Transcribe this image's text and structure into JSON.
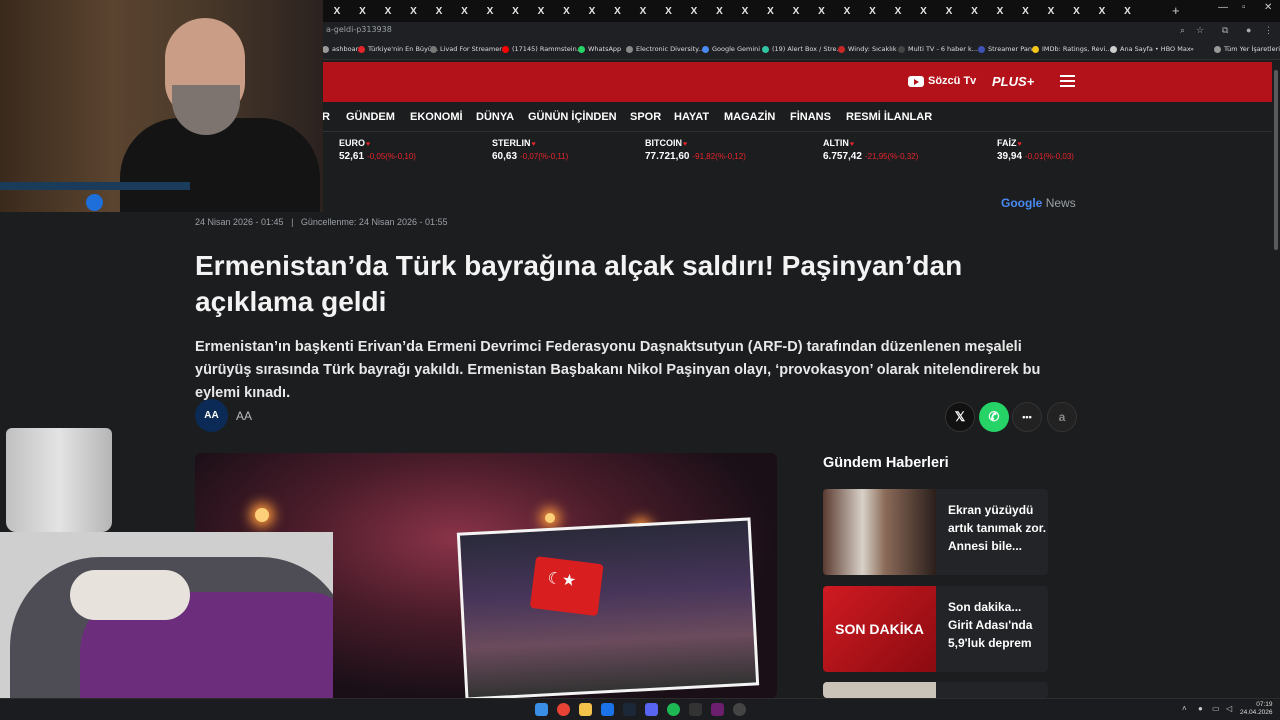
{
  "browser": {
    "tab_icon": "X",
    "tab_count": 32,
    "url": "a-geldi-p313938",
    "bookmarks": [
      {
        "label": "ashboard",
        "color": "#999999"
      },
      {
        "label": "Türkiye'nin En Büyü...",
        "color": "#e5252c"
      },
      {
        "label": "Livad For Streamers",
        "color": "#777777"
      },
      {
        "label": "(17145) Rammstein...",
        "color": "#ff0000"
      },
      {
        "label": "WhatsApp",
        "color": "#25d366"
      },
      {
        "label": "Electronic Diversity...",
        "color": "#888888"
      },
      {
        "label": "Google Gemini",
        "color": "#4a8af4"
      },
      {
        "label": "(19) Alert Box / Stre...",
        "color": "#31c3a2"
      },
      {
        "label": "Windy: Sıcaklık",
        "color": "#c62828"
      },
      {
        "label": "Multi TV - 6 haber k...",
        "color": "#444444"
      },
      {
        "label": "Streamer Panel",
        "color": "#3f51b5"
      },
      {
        "label": "IMDb: Ratings, Revi...",
        "color": "#f5c518"
      },
      {
        "label": "Ana Sayfa • HBO Max",
        "color": "#cccccc"
      },
      {
        "label": "»",
        "color": ""
      },
      {
        "label": "Tüm Yer İşaretleri",
        "color": "#999999"
      }
    ]
  },
  "site": {
    "sozcu_tv": "Sözcü Tv",
    "plus": "PLUS+",
    "nav": [
      "R",
      "GÜNDEM",
      "EKONOMİ",
      "DÜNYA",
      "GÜNÜN İÇİNDEN",
      "SPOR",
      "HAYAT",
      "MAGAZİN",
      "FİNANS",
      "RESMİ İLANLAR"
    ],
    "markets": [
      {
        "name": "EURO",
        "value": "52,61",
        "change": "-0,05(%-0,10)"
      },
      {
        "name": "STERLIN",
        "value": "60,63",
        "change": "-0,07(%-0,11)"
      },
      {
        "name": "BITCOIN",
        "value": "77.721,60",
        "change": "-91,82(%-0,12)"
      },
      {
        "name": "ALTIN",
        "value": "6.757,42",
        "change": "-21,95(%-0,32)"
      },
      {
        "name": "FAİZ",
        "value": "39,94",
        "change": "-0,01(%-0,03)"
      }
    ],
    "google_news": {
      "google": "Google",
      "news": "News"
    }
  },
  "article": {
    "dates": "24 Nisan 2026 - 01:45   |   Güncellenme: 24 Nisan 2026 - 01:55",
    "headline": "Ermenistan’da Türk bayrağına alçak saldırı! Paşinyan’dan açıklama geldi",
    "lead": "Ermenistan’ın başkenti Erivan’da Ermeni Devrimci Federasyonu Daşnaktsutyun (ARF-D) tarafından düzenlenen meşaleli yürüyüş sırasında Türk bayrağı yakıldı. Ermenistan Başbakanı Nikol Paşinyan olayı, ‘provokasyon’ olarak nitelendirerek bu eylemi kınadı.",
    "source_logo": "AA",
    "source": "AA"
  },
  "share": {
    "x": "𝕏",
    "whatsapp": "✆",
    "more": "•••",
    "font": "a"
  },
  "sidebar": {
    "title": "Gündem Haberleri",
    "items": [
      {
        "text": "Ekran yüzüydü artık tanımak zor. Annesi bile..."
      },
      {
        "text": "Son dakika... Girit Adası'nda 5,9'luk deprem",
        "thumb_label": "SON DAKİKA"
      }
    ]
  },
  "taskbar": {
    "time": "07:19",
    "date": "24.04.2026"
  }
}
